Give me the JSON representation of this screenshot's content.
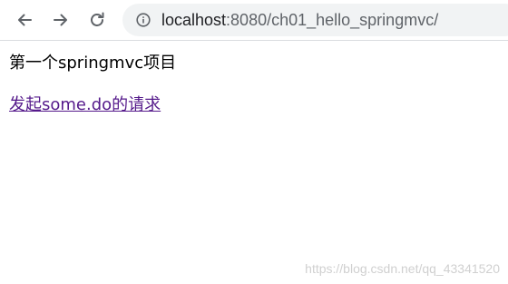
{
  "browser": {
    "url_host": "localhost",
    "url_rest": ":8080/ch01_hello_springmvc/"
  },
  "page": {
    "heading": "第一个springmvc项目",
    "link_text": "发起some.do的请求"
  },
  "watermark": "https://blog.csdn.net/qq_43341520",
  "colors": {
    "link_visited": "#551a8b",
    "omnibox_bg": "#f1f3f4"
  },
  "icons": {
    "back": "back-arrow-icon",
    "forward": "forward-arrow-icon",
    "reload": "reload-icon",
    "info": "info-icon"
  }
}
